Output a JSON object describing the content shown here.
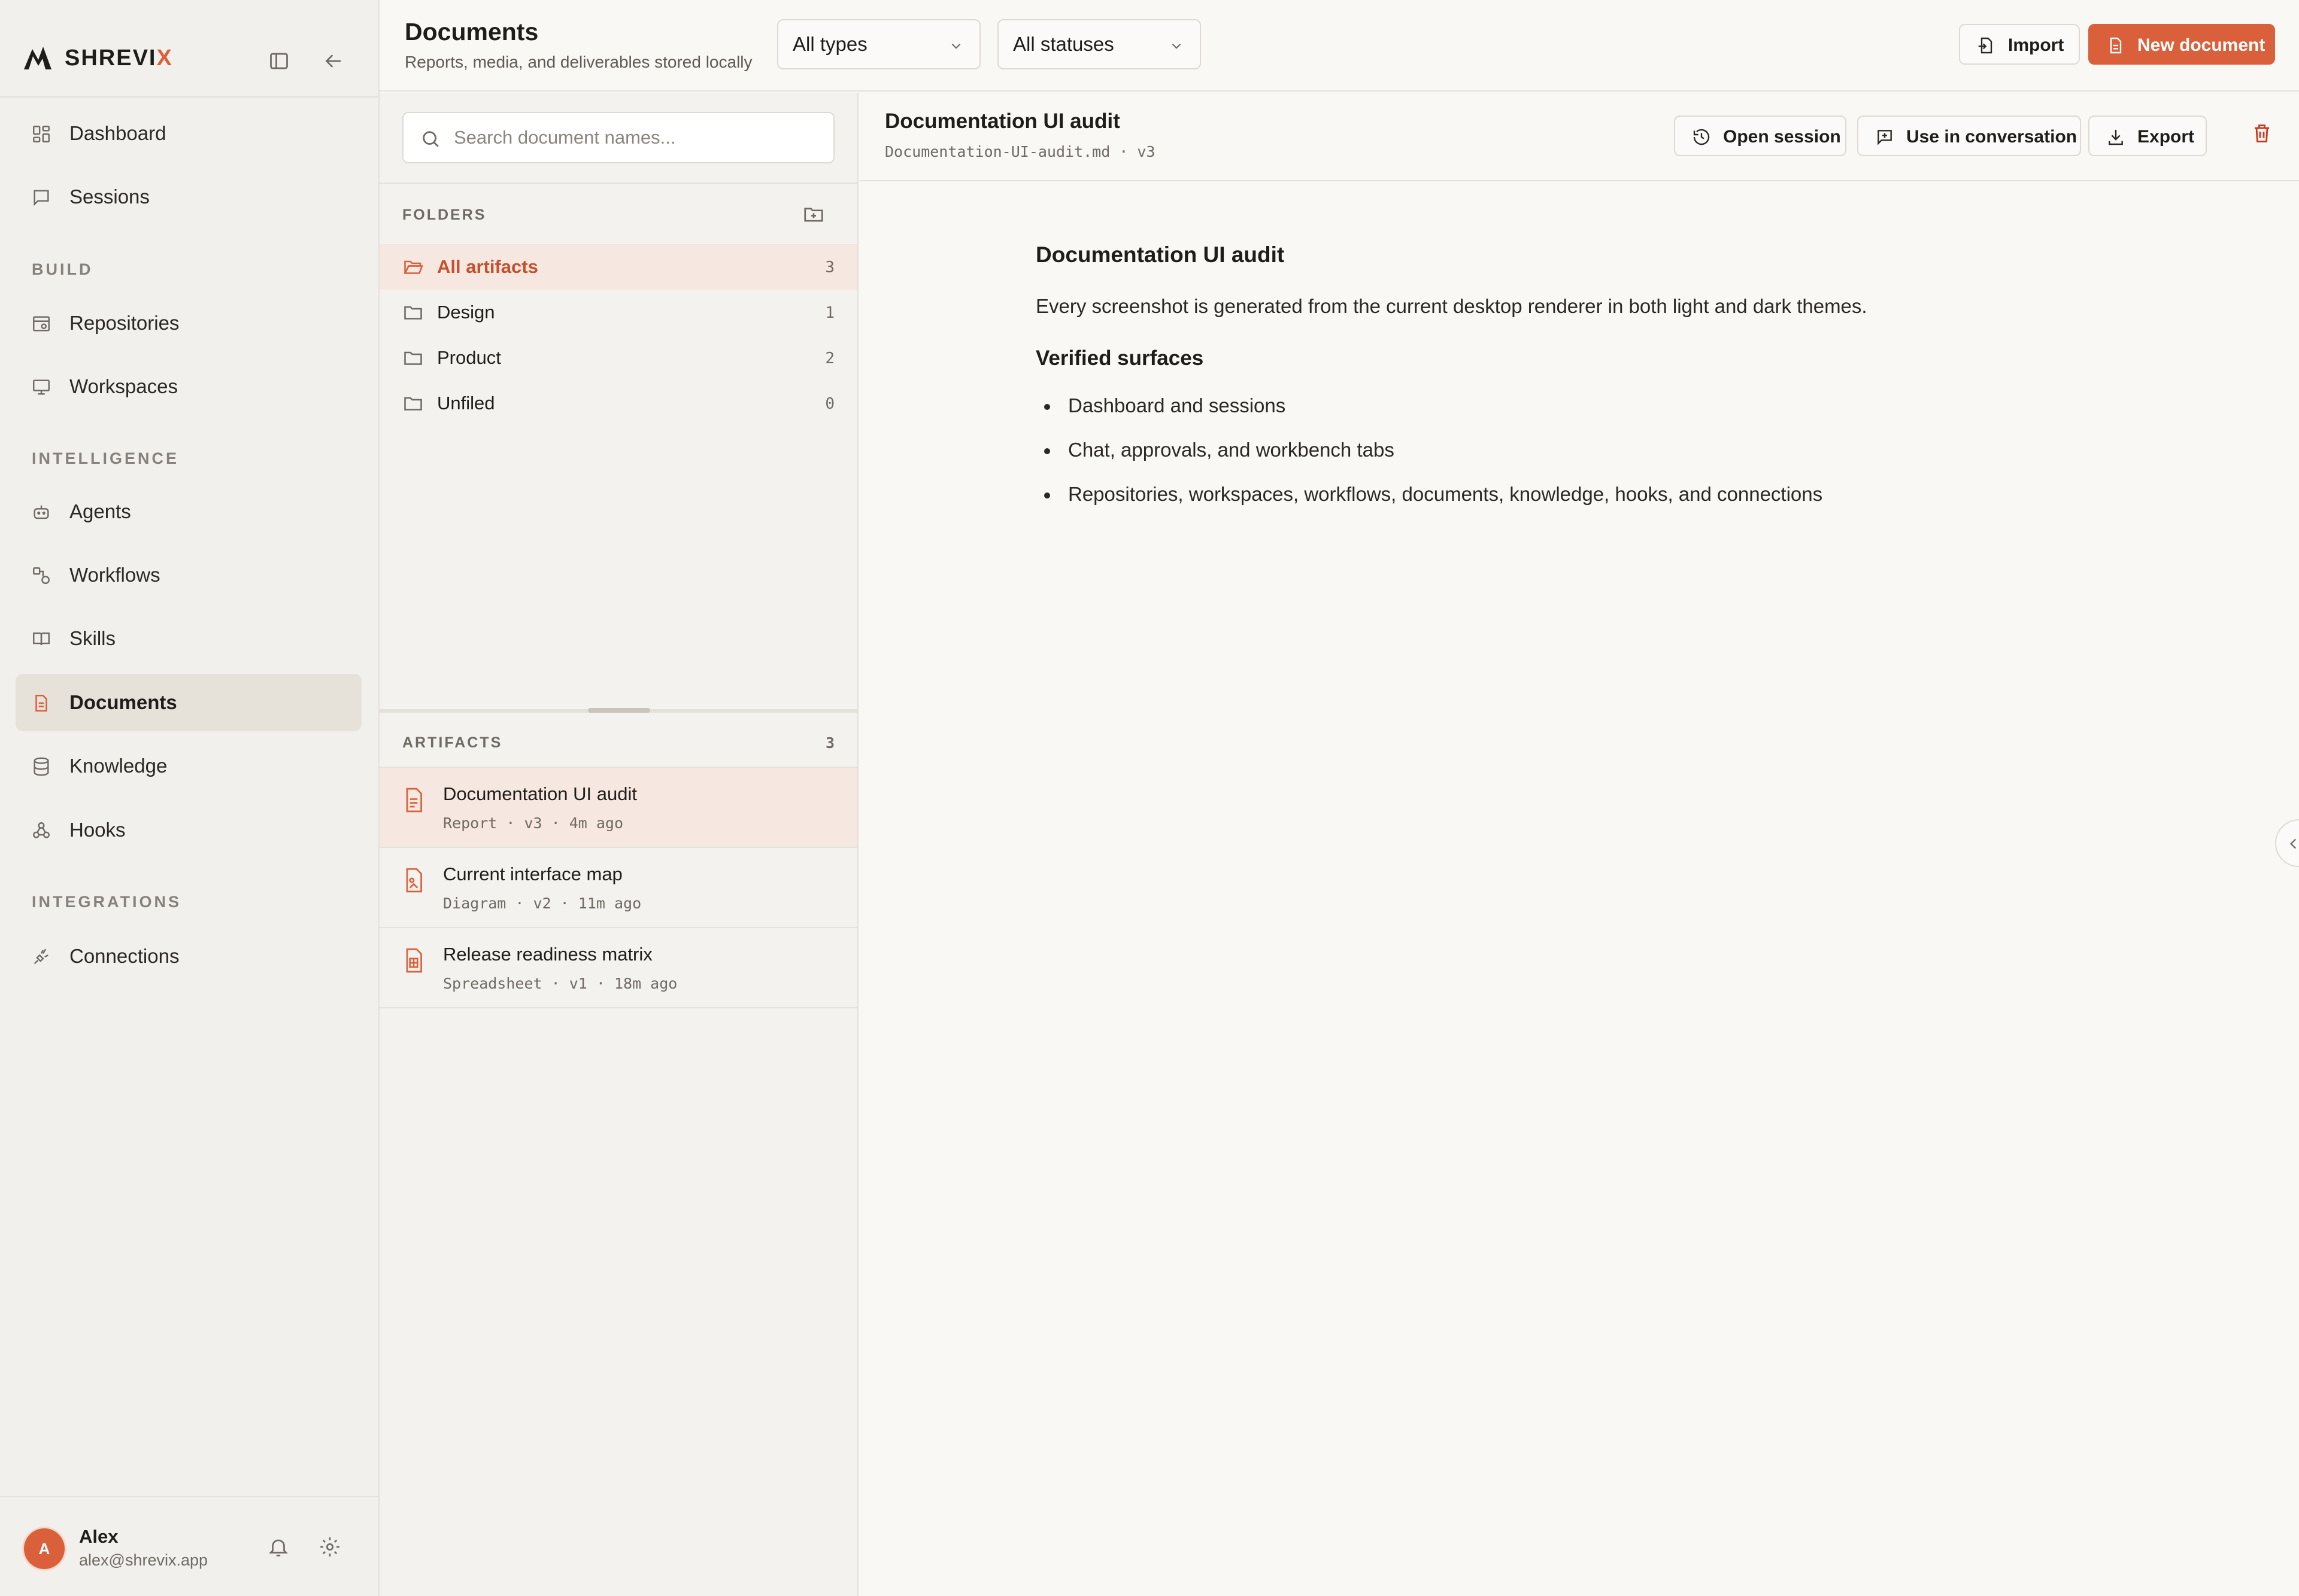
{
  "brand": {
    "name_main": "SHREVI",
    "name_accent": "X"
  },
  "sidebar": {
    "items": [
      {
        "label": "Dashboard"
      },
      {
        "label": "Sessions"
      },
      {
        "label": "Repositories"
      },
      {
        "label": "Workspaces"
      },
      {
        "label": "Agents"
      },
      {
        "label": "Workflows"
      },
      {
        "label": "Skills"
      },
      {
        "label": "Documents"
      },
      {
        "label": "Knowledge"
      },
      {
        "label": "Hooks"
      },
      {
        "label": "Connections"
      }
    ],
    "sections": {
      "build": "BUILD",
      "intelligence": "INTELLIGENCE",
      "integrations": "INTEGRATIONS"
    },
    "active_item": "Documents",
    "user": {
      "initial": "A",
      "name": "Alex",
      "email": "alex@shrevix.app"
    }
  },
  "header": {
    "title": "Documents",
    "subtitle": "Reports, media, and deliverables stored locally",
    "type_filter": "All types",
    "status_filter": "All statuses",
    "import_label": "Import",
    "new_label": "New document"
  },
  "search": {
    "placeholder": "Search document names..."
  },
  "folders": {
    "label": "FOLDERS",
    "items": [
      {
        "name": "All artifacts",
        "count": "3"
      },
      {
        "name": "Design",
        "count": "1"
      },
      {
        "name": "Product",
        "count": "2"
      },
      {
        "name": "Unfiled",
        "count": "0"
      }
    ]
  },
  "artifacts": {
    "label": "ARTIFACTS",
    "count": "3",
    "items": [
      {
        "title": "Documentation UI audit",
        "meta": "Report · v3 · 4m ago"
      },
      {
        "title": "Current interface map",
        "meta": "Diagram · v2 · 11m ago"
      },
      {
        "title": "Release readiness matrix",
        "meta": "Spreadsheet · v1 · 18m ago"
      }
    ]
  },
  "document": {
    "title": "Documentation UI audit",
    "file": "Documentation-UI-audit.md · v3",
    "actions": {
      "open_session": "Open session",
      "use_in_conversation": "Use in conversation",
      "export": "Export"
    },
    "body": {
      "heading": "Documentation UI audit",
      "paragraph": "Every screenshot is generated from the current desktop renderer in both light and dark themes.",
      "subheading": "Verified surfaces",
      "bullets": [
        "Dashboard and sessions",
        "Chat, approvals, and workbench tabs",
        "Repositories, workspaces, workflows, documents, knowledge, hooks, and connections"
      ]
    }
  },
  "colors": {
    "accent": "#d9603b",
    "sidebar_bg": "#f2f0ec",
    "active_row": "#f7e7e1"
  }
}
